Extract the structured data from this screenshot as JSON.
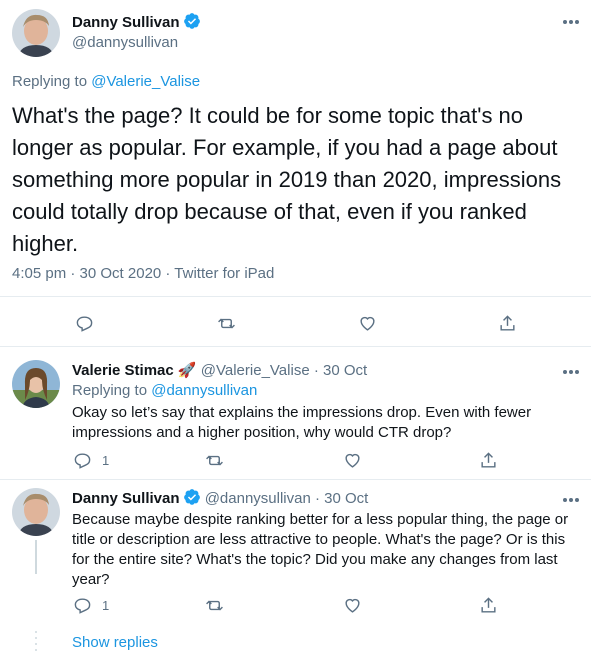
{
  "main_tweet": {
    "author_name": "Danny Sullivan",
    "author_handle": "@dannysullivan",
    "replying_prefix": "Replying to ",
    "replying_to": "@Valerie_Valise",
    "text": "What's the page? It could be for some topic that's no longer as popular. For example, if you had a page about something more popular in 2019 than 2020, impressions could totally drop because of that, even if you ranked higher.",
    "timestamp": "4:05 pm · 30 Oct 2020 · Twitter for iPad"
  },
  "replies": [
    {
      "author_name": "Valerie Stimac",
      "name_emoji": "🚀",
      "author_handle": "@Valerie_Valise",
      "date": "· 30 Oct",
      "replying_prefix": "Replying to ",
      "replying_to": "@dannysullivan",
      "text": "Okay so let’s say that explains the impressions drop. Even with fewer impressions and a higher position, why would CTR drop?",
      "reply_count": "1"
    },
    {
      "author_name": "Danny Sullivan",
      "author_handle": "@dannysullivan",
      "date": "· 30 Oct",
      "text": "Because maybe despite ranking better for a less popular thing, the page or title or description are less attractive to people.  What's the page? Or is this for the entire site? What's the topic? Did you make any changes from last year?",
      "reply_count": "1"
    }
  ],
  "show_replies": "Show replies",
  "colors": {
    "accent": "#1b95e0",
    "verified": "#1da1f2",
    "muted": "#5b7083",
    "divider": "#e6ecf0"
  },
  "icons": [
    "verified-badge-icon",
    "more-icon",
    "reply-icon",
    "retweet-icon",
    "like-icon",
    "share-icon",
    "rocket-emoji"
  ]
}
